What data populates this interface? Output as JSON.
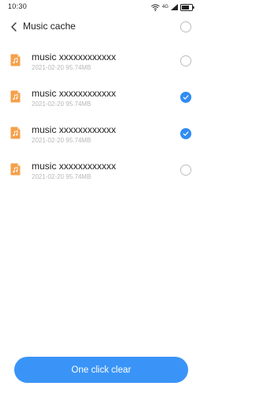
{
  "status_bar": {
    "time": "10:30",
    "network": "4G"
  },
  "header": {
    "title": "Music cache",
    "select_all_checked": false
  },
  "colors": {
    "accent": "#3a94f7",
    "check": "#2f8cf2",
    "file_icon": "#f5a04a"
  },
  "files": [
    {
      "name": "music xxxxxxxxxxxx",
      "date": "2021-02-20",
      "size": "95.74MB",
      "checked": false,
      "icon": "music-file-icon"
    },
    {
      "name": "music xxxxxxxxxxxx",
      "date": "2021-02-20",
      "size": "95.74MB",
      "checked": true,
      "icon": "music-file-icon"
    },
    {
      "name": "music xxxxxxxxxxxx",
      "date": "2021-02-20",
      "size": "95.74MB",
      "checked": true,
      "icon": "music-file-icon"
    },
    {
      "name": "music xxxxxxxxxxxx",
      "date": "2021-02-20",
      "size": "95.74MB",
      "checked": false,
      "icon": "music-file-icon"
    }
  ],
  "footer": {
    "clear_label": "One click clear"
  }
}
